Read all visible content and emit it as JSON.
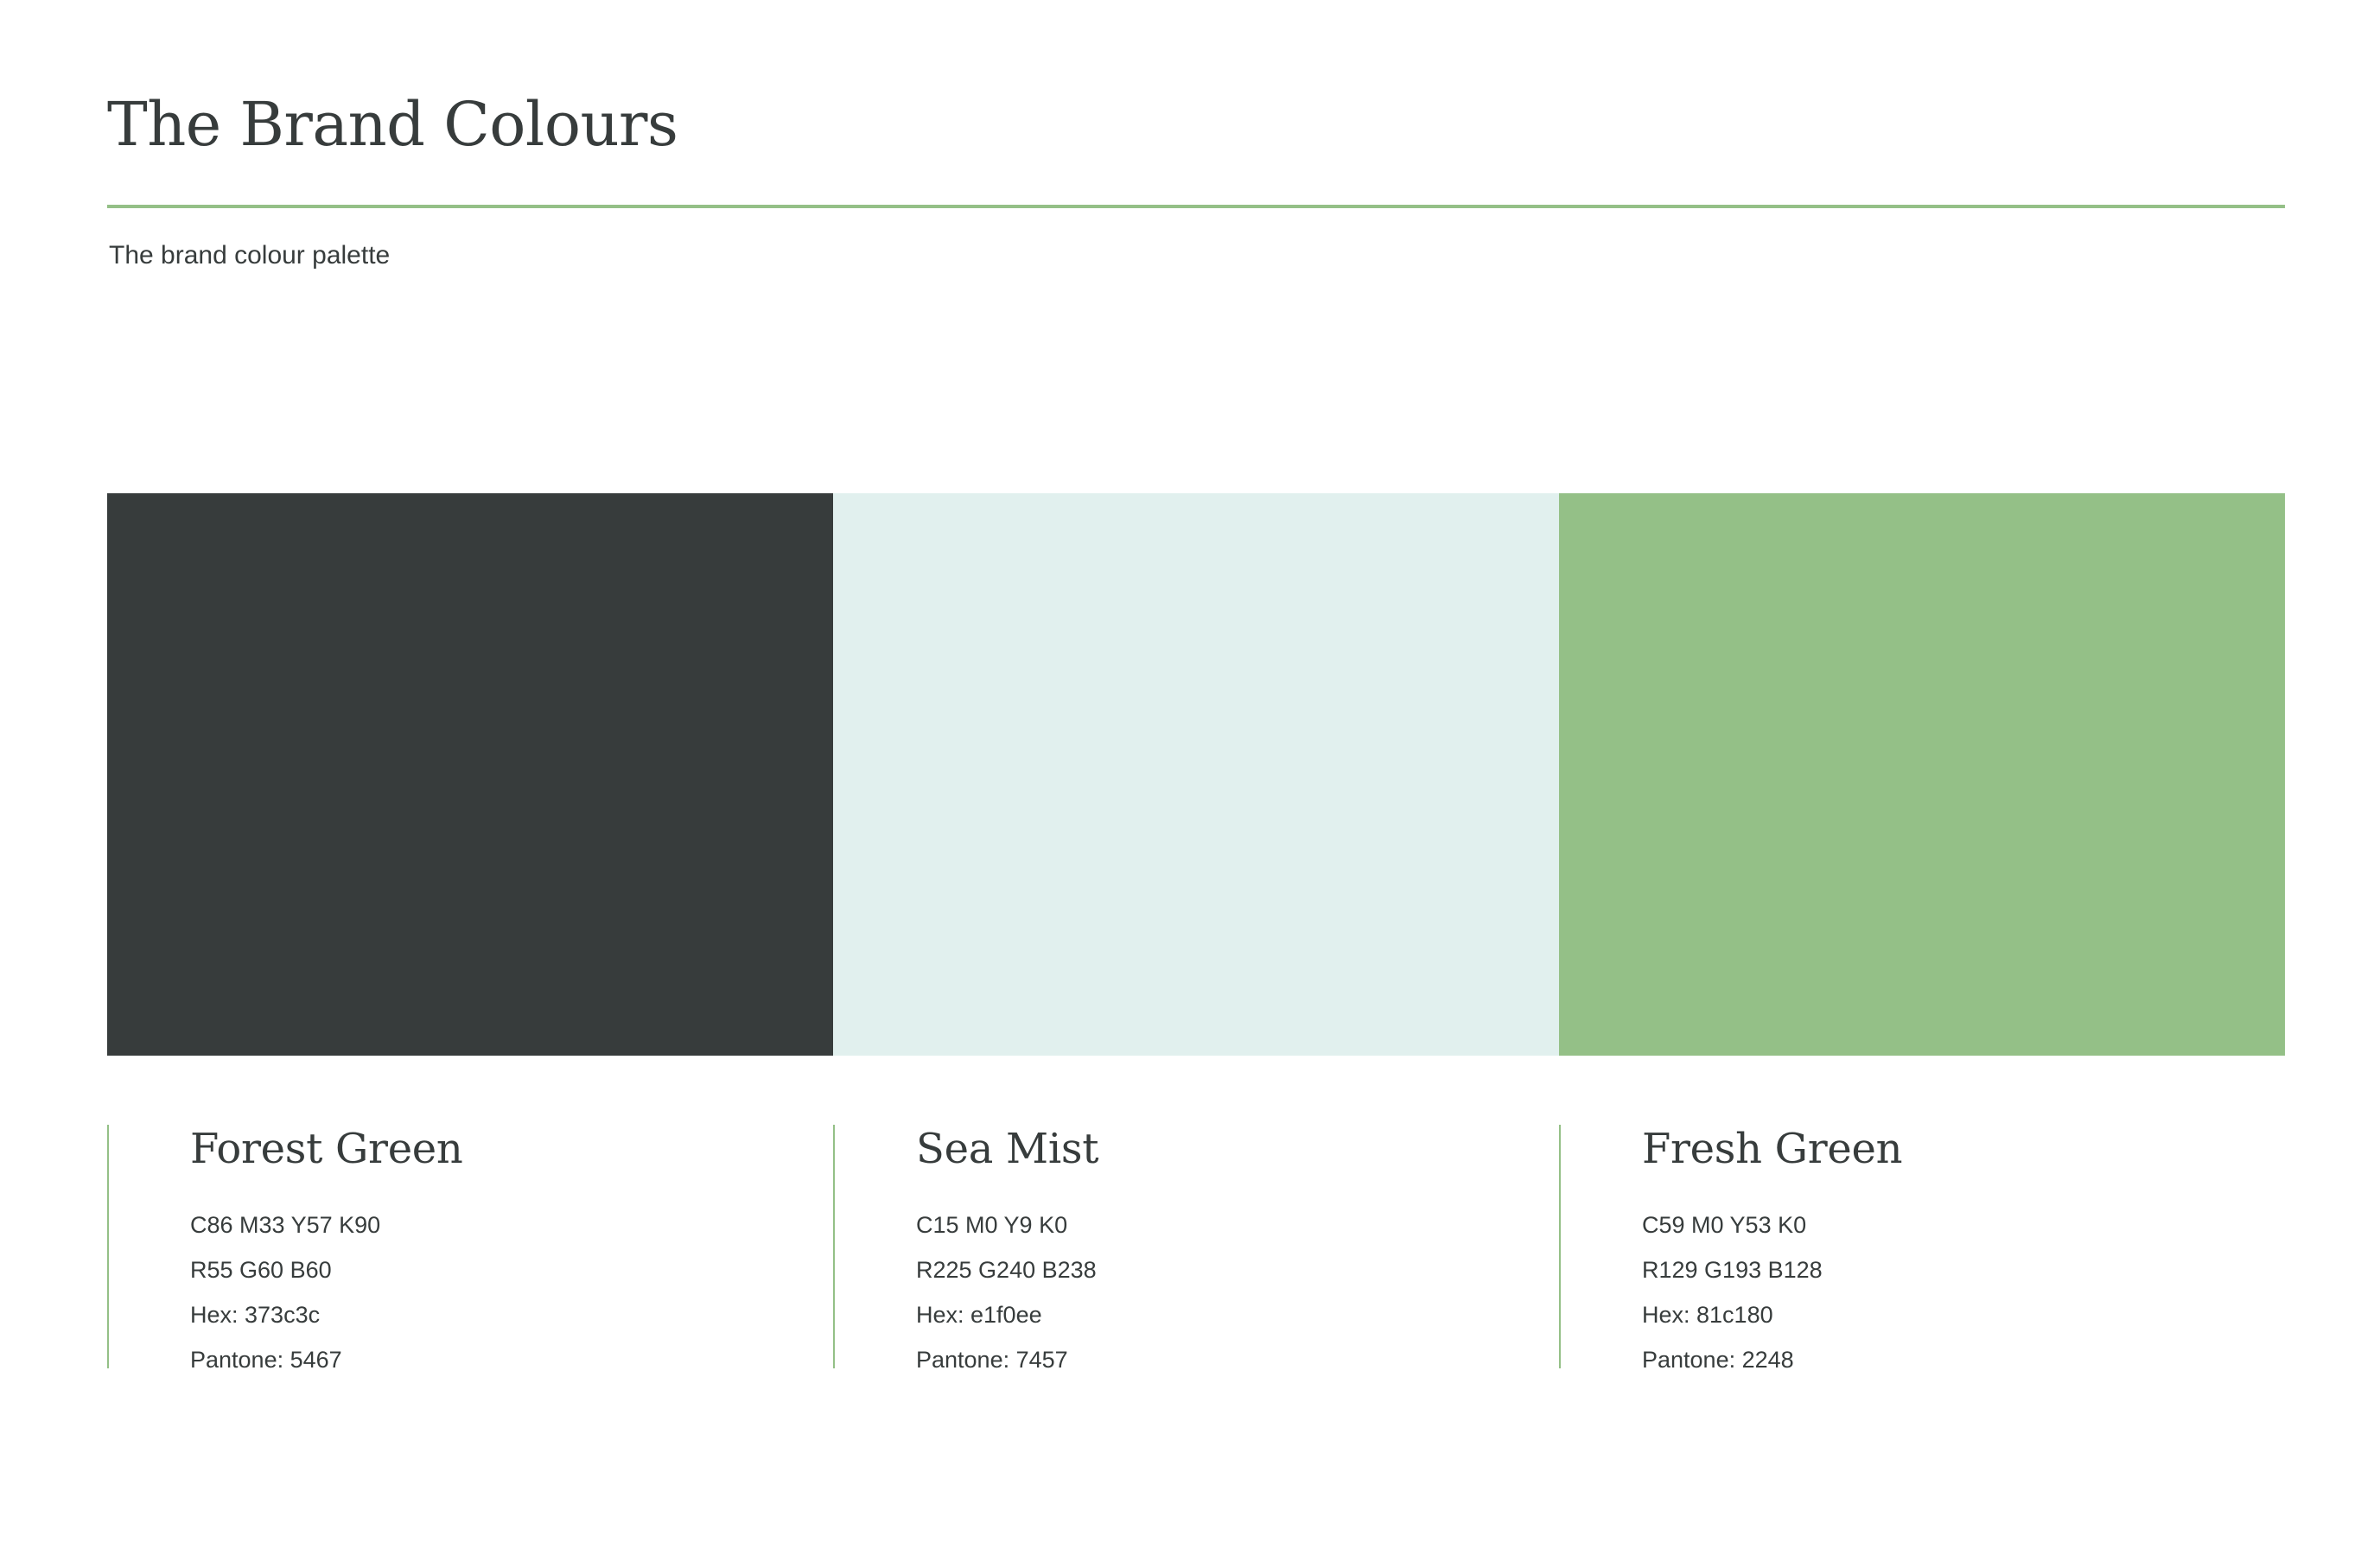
{
  "header": {
    "title": "The Brand Colours",
    "subtitle": "The brand colour palette",
    "rule_color": "#94c087"
  },
  "colours": [
    {
      "name": "Forest Green",
      "swatch_color": "#373c3c",
      "cmyk": "C86 M33 Y57 K90",
      "rgb": "R55 G60 B60",
      "hex": "Hex: 373c3c",
      "pantone": "Pantone: 5467"
    },
    {
      "name": "Sea Mist",
      "swatch_color": "#e1f0ee",
      "cmyk": "C15 M0 Y9 K0",
      "rgb": "R225 G240 B238",
      "hex": "Hex: e1f0ee",
      "pantone": "Pantone: 7457"
    },
    {
      "name": "Fresh Green",
      "swatch_color": "#94c087",
      "cmyk": "C59 M0 Y53 K0",
      "rgb": "R129 G193 B128",
      "hex": "Hex: 81c180",
      "pantone": "Pantone: 2248"
    }
  ]
}
